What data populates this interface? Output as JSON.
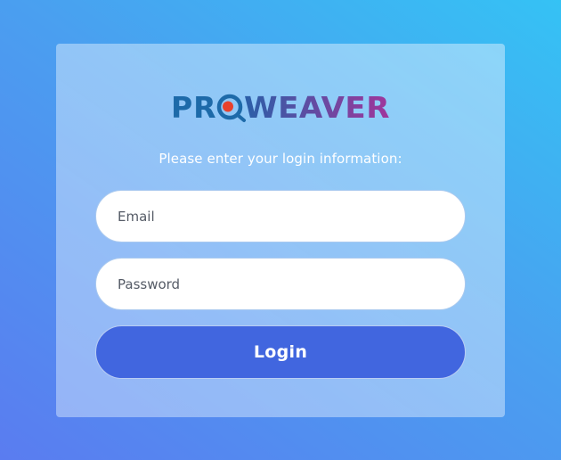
{
  "brand": {
    "logo_text": "PROWEAVER",
    "colors": {
      "pro": "#1f67a6",
      "weaver": "#8d3f9f",
      "dot": "#e8412c"
    }
  },
  "login_form": {
    "instructions": "Please enter your login information:",
    "email_placeholder": "Email",
    "password_placeholder": "Password",
    "login_label": "Login"
  },
  "theme": {
    "accent": "#4166df",
    "background_top": "#35c2f4",
    "background_bottom": "#5a7cf0"
  }
}
